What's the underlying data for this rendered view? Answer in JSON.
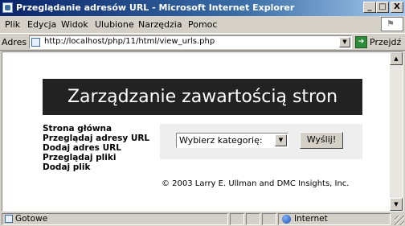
{
  "window": {
    "title": "Przeglądanie adresów URL - Microsoft Internet Explorer",
    "controls": {
      "minimize": "_",
      "maximize": "□",
      "close": "X"
    }
  },
  "menu": {
    "items": [
      {
        "label": "Plik"
      },
      {
        "label": "Edycja"
      },
      {
        "label": "Widok"
      },
      {
        "label": "Ulubione"
      },
      {
        "label": "Narzędzia"
      },
      {
        "label": "Pomoc"
      }
    ]
  },
  "address": {
    "label": "Adres",
    "url": "http://localhost/php/11/html/view_urls.php",
    "go_label": "Przejdź"
  },
  "page": {
    "header": "Zarządzanie zawartością stron",
    "nav": [
      {
        "label": "Strona główna"
      },
      {
        "label": "Przeglądaj adresy URL"
      },
      {
        "label": "Dodaj adres URL"
      },
      {
        "label": "Przeglądaj pliki"
      },
      {
        "label": "Dodaj plik"
      }
    ],
    "category_select": {
      "selected": "Wybierz kategorię:"
    },
    "submit_label": "Wyślij!",
    "footer": "© 2003 Larry E. Ullman and DMC Insights, Inc."
  },
  "status": {
    "text": "Gotowe",
    "zone": "Internet"
  }
}
